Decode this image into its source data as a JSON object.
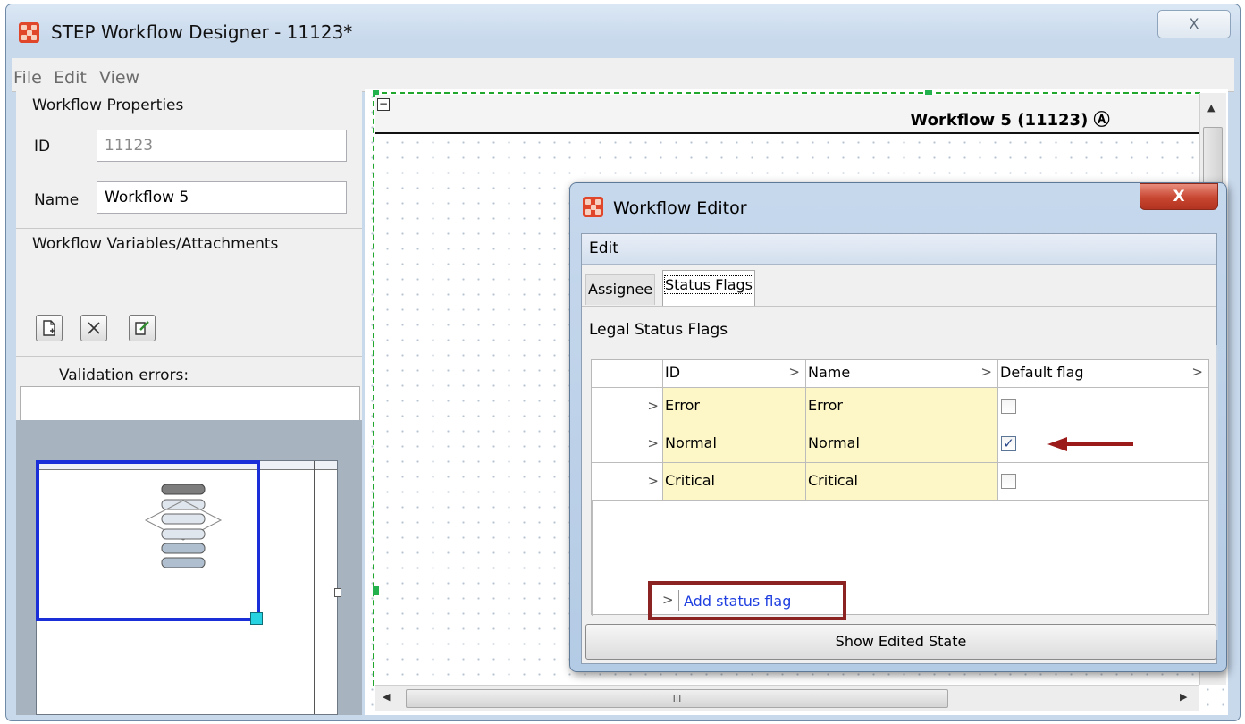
{
  "window": {
    "title": "STEP Workflow Designer - 11123*",
    "close_glyph": "X"
  },
  "menubar": {
    "items": [
      "File",
      "Edit",
      "View"
    ]
  },
  "left_panel": {
    "heading": "Workflow Properties",
    "id_label": "ID",
    "id_value": "11123",
    "name_label": "Name",
    "name_value": "Workflow 5",
    "variables_heading": "Workflow Variables/Attachments",
    "toolbar_icons": [
      "new-icon",
      "delete-icon",
      "edit-icon"
    ],
    "validation_label": "Validation errors:",
    "validation_value": ""
  },
  "canvas": {
    "workflow_title": "Workflow 5 (11123) Ⓐ",
    "scroll_glyph": "III"
  },
  "dialog": {
    "title": "Workflow Editor",
    "close_glyph": "X",
    "menu_label": "Edit",
    "tabs": [
      "Assignee",
      "Status Flags"
    ],
    "active_tab": "Status Flags",
    "section_label": "Legal Status Flags",
    "columns": [
      "ID",
      "Name",
      "Default flag"
    ],
    "rows": [
      {
        "id": "Error",
        "name": "Error",
        "default_flag": false
      },
      {
        "id": "Normal",
        "name": "Normal",
        "default_flag": true
      },
      {
        "id": "Critical",
        "name": "Critical",
        "default_flag": false
      }
    ],
    "add_link": "Add status flag",
    "show_button": "Show Edited State",
    "highlight_color": "#8b2322",
    "arrow_color": "#9b1b1b"
  },
  "colors": {
    "app_icon": "#e0462a",
    "navigator_frame": "#1a2fd8",
    "selection_handle": "#22b14c"
  }
}
